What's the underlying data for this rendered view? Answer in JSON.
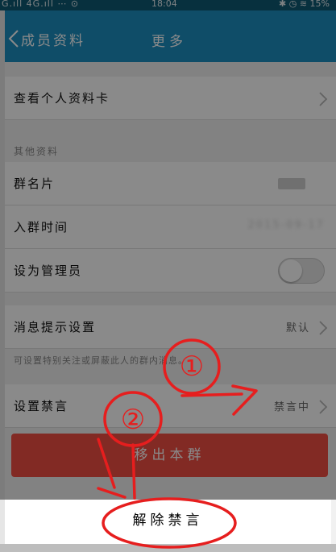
{
  "status_bar": {
    "left_text": "G.ıll 4G.ıll ⋯ ⊙",
    "time": "18:04",
    "right_text": "✱ ◷ ≋ 15%"
  },
  "nav": {
    "back_label": "成员资料",
    "title": "更多"
  },
  "rows": {
    "profile_card": "查看个人资料卡",
    "section_other": "其他资料",
    "group_card": "群名片",
    "join_time": "入群时间",
    "join_time_value": "2015-09-17",
    "set_admin": "设为管理员",
    "notify_settings": "消息提示设置",
    "notify_value": "默认",
    "notify_hint": "可设置特别关注或屏蔽此人的群内消息。",
    "mute_settings": "设置禁言",
    "mute_value": "禁言中"
  },
  "leave_button": "移出本群",
  "action_sheet": {
    "unmute": "解除禁言"
  },
  "annotations": {
    "marker_1": "①",
    "marker_2": "②"
  },
  "toggle": {
    "set_admin_on": false
  },
  "colors": {
    "nav": "#1d8fc1",
    "danger": "#f04f43",
    "annotation": "#e61e1e"
  }
}
